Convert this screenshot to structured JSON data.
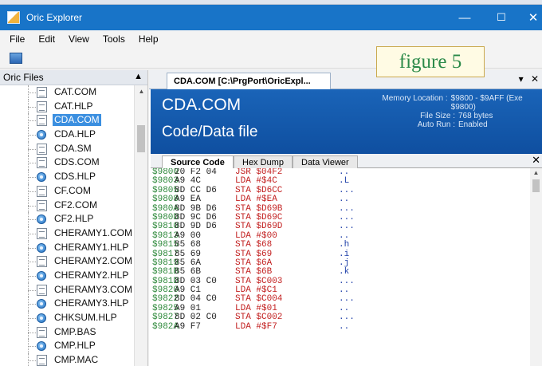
{
  "window": {
    "title": "Oric Explorer"
  },
  "titlebar_controls": {
    "minimize": "—",
    "maximize": "☐",
    "close": "✕"
  },
  "menu": [
    "File",
    "Edit",
    "View",
    "Tools",
    "Help"
  ],
  "figure_label": "figure 5",
  "left_panel": {
    "title": "Oric Files",
    "pin": "▲",
    "files": [
      {
        "name": "CAT.COM",
        "icon": "doc-icon"
      },
      {
        "name": "CAT.HLP",
        "icon": "doc-icon"
      },
      {
        "name": "CDA.COM",
        "icon": "doc-icon",
        "selected": true
      },
      {
        "name": "CDA.HLP",
        "icon": "help-icon"
      },
      {
        "name": "CDA.SM",
        "icon": "doc-icon"
      },
      {
        "name": "CDS.COM",
        "icon": "doc-icon"
      },
      {
        "name": "CDS.HLP",
        "icon": "help-icon"
      },
      {
        "name": "CF.COM",
        "icon": "doc-icon"
      },
      {
        "name": "CF2.COM",
        "icon": "doc-icon"
      },
      {
        "name": "CF2.HLP",
        "icon": "help-icon"
      },
      {
        "name": "CHERAMY1.COM",
        "icon": "doc-icon"
      },
      {
        "name": "CHERAMY1.HLP",
        "icon": "help-icon"
      },
      {
        "name": "CHERAMY2.COM",
        "icon": "doc-icon"
      },
      {
        "name": "CHERAMY2.HLP",
        "icon": "help-icon"
      },
      {
        "name": "CHERAMY3.COM",
        "icon": "doc-icon"
      },
      {
        "name": "CHERAMY3.HLP",
        "icon": "help-icon"
      },
      {
        "name": "CHKSUM.HLP",
        "icon": "help-icon"
      },
      {
        "name": "CMP.BAS",
        "icon": "doc-icon"
      },
      {
        "name": "CMP.HLP",
        "icon": "help-icon"
      },
      {
        "name": "CMP.MAC",
        "icon": "doc-icon"
      }
    ]
  },
  "document": {
    "tab_label": "CDA.COM [C:\\PrgPort\\OricExpl...",
    "tab_controls": [
      "▾",
      "✕"
    ],
    "banner": {
      "file_name": "CDA.COM",
      "file_type": "Code/Data file",
      "meta": [
        {
          "key": "Memory Location :",
          "value": "$9800 - $9AFF (Exe $9800)"
        },
        {
          "key": "File Size :",
          "value": "768 bytes"
        },
        {
          "key": "Auto Run :",
          "value": "Enabled"
        }
      ]
    },
    "subtabs": [
      "Source Code",
      "Hex Dump",
      "Data Viewer"
    ],
    "active_subtab": "Source Code",
    "close_glyph": "✕",
    "code": [
      {
        "addr": "$9800",
        "hex": "20 F2 04",
        "asm": "JSR $04F2",
        "txt": ".."
      },
      {
        "addr": "$9803",
        "hex": "A9 4C",
        "asm": "LDA #$4C",
        "txt": ".L"
      },
      {
        "addr": "$9805",
        "hex": "8D CC D6",
        "asm": "STA $D6CC",
        "txt": "..."
      },
      {
        "addr": "$9808",
        "hex": "A9 EA",
        "asm": "LDA #$EA",
        "txt": ".."
      },
      {
        "addr": "$980A",
        "hex": "8D 9B D6",
        "asm": "STA $D69B",
        "txt": "..."
      },
      {
        "addr": "$980D",
        "hex": "8D 9C D6",
        "asm": "STA $D69C",
        "txt": "..."
      },
      {
        "addr": "$9810",
        "hex": "8D 9D D6",
        "asm": "STA $D69D",
        "txt": "..."
      },
      {
        "addr": "$9813",
        "hex": "A9 00",
        "asm": "LDA #$00",
        "txt": ".."
      },
      {
        "addr": "$9815",
        "hex": "85 68",
        "asm": "STA $68",
        "txt": ".h"
      },
      {
        "addr": "$9817",
        "hex": "85 69",
        "asm": "STA $69",
        "txt": ".i"
      },
      {
        "addr": "$9819",
        "hex": "85 6A",
        "asm": "STA $6A",
        "txt": ".j"
      },
      {
        "addr": "$981B",
        "hex": "85 6B",
        "asm": "STA $6B",
        "txt": ".k"
      },
      {
        "addr": "$981D",
        "hex": "8D 03 C0",
        "asm": "STA $C003",
        "txt": "..."
      },
      {
        "addr": "$9820",
        "hex": "A9 C1",
        "asm": "LDA #$C1",
        "txt": ".."
      },
      {
        "addr": "$9822",
        "hex": "8D 04 C0",
        "asm": "STA $C004",
        "txt": "..."
      },
      {
        "addr": "$9825",
        "hex": "A9 01",
        "asm": "LDA #$01",
        "txt": ".."
      },
      {
        "addr": "$9827",
        "hex": "8D 02 C0",
        "asm": "STA $C002",
        "txt": "..."
      },
      {
        "addr": "$982A",
        "hex": "A9 F7",
        "asm": "LDA #$F7",
        "txt": ".."
      }
    ]
  }
}
